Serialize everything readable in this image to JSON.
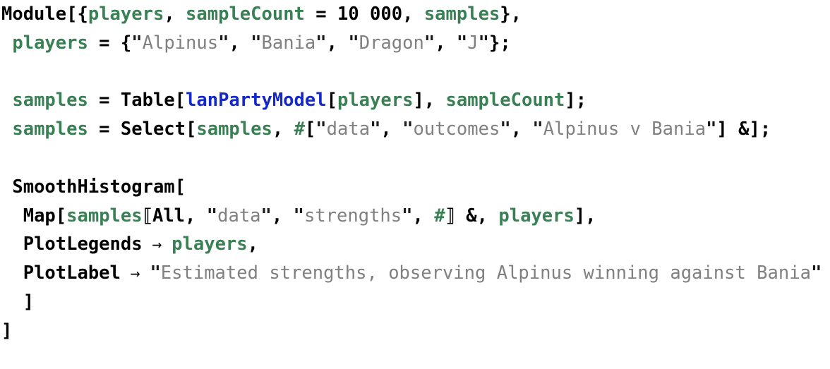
{
  "cell": {
    "kind": "wolfram-language-input-cell",
    "background_color": "#ffffff",
    "colors": {
      "symbol": "#000000",
      "local_variable": "#3a8055",
      "undefined_symbol": "#1528c8",
      "string": "#808080",
      "quote": "#1a1a1a"
    }
  },
  "code": {
    "line1": {
      "a_module": "Module",
      "b_open_bracket": "[{",
      "c_players": "players",
      "d_comma": ", ",
      "e_samplecount": "sampleCount",
      "f_equals": " = ",
      "g_number": "10 000",
      "h_comma": ", ",
      "i_samples": "samples",
      "j_close": "},"
    },
    "line2": {
      "indent": " ",
      "a_players": "players",
      "b_equals": " = ",
      "c_open": "{",
      "d_q1": "\"",
      "e_s1": "Alpinus",
      "f_q2": "\"",
      "g_comma1": ", ",
      "h_q3": "\"",
      "i_s2": "Bania",
      "j_q4": "\"",
      "k_comma2": ", ",
      "l_q5": "\"",
      "m_s3": "Dragon",
      "n_q6": "\"",
      "o_comma3": ", ",
      "p_q7": "\"",
      "q_s4": "J",
      "r_q8": "\"",
      "s_close": "};"
    },
    "line4": {
      "indent": " ",
      "a_samples": "samples",
      "b_equals": " = ",
      "c_table": "Table",
      "d_open": "[",
      "e_model": "lanPartyModel",
      "f_open2": "[",
      "g_players": "players",
      "h_close2": "], ",
      "i_samplecount": "sampleCount",
      "j_close": "];"
    },
    "line5": {
      "indent": " ",
      "a_samples": "samples",
      "b_equals": " = ",
      "c_select": "Select",
      "d_open": "[",
      "e_samples2": "samples",
      "f_comma": ", ",
      "g_slot": "#",
      "h_open2": "[",
      "i_q1": "\"",
      "j_s1": "data",
      "k_q2": "\"",
      "l_comma1": ", ",
      "m_q3": "\"",
      "n_s2": "outcomes",
      "o_q4": "\"",
      "p_comma2": ", ",
      "q_q5": "\"",
      "r_s3": "Alpinus v Bania",
      "s_q6": "\"",
      "t_close2": "] ",
      "u_amp": "&",
      "v_close": "];"
    },
    "line7": {
      "indent": " ",
      "a_func": "SmoothHistogram",
      "b_open": "["
    },
    "line8": {
      "indent": "  ",
      "a_map": "Map",
      "b_open": "[",
      "c_samples": "samples",
      "d_dopen": "⟦",
      "e_all": "All",
      "f_comma1": ", ",
      "g_q1": "\"",
      "h_s1": "data",
      "i_q2": "\"",
      "j_comma2": ", ",
      "k_q3": "\"",
      "l_s2": "strengths",
      "m_q4": "\"",
      "n_comma3": ", ",
      "o_slot": "#",
      "p_dclose": "⟧",
      "q_amp": " &, ",
      "r_players": "players",
      "s_close": "],"
    },
    "line9": {
      "indent": "  ",
      "a_opt": "PlotLegends",
      "b_arrow": " → ",
      "c_players": "players",
      "d_comma": ","
    },
    "line10": {
      "indent": "  ",
      "a_opt": "PlotLabel",
      "b_arrow": " → ",
      "c_q1": "\"",
      "d_label": "Estimated strengths, observing Alpinus winning against Bania",
      "e_q2": "\""
    },
    "line11": {
      "indent": "  ",
      "a_close": "]"
    },
    "line12": {
      "a_close": "]"
    }
  }
}
